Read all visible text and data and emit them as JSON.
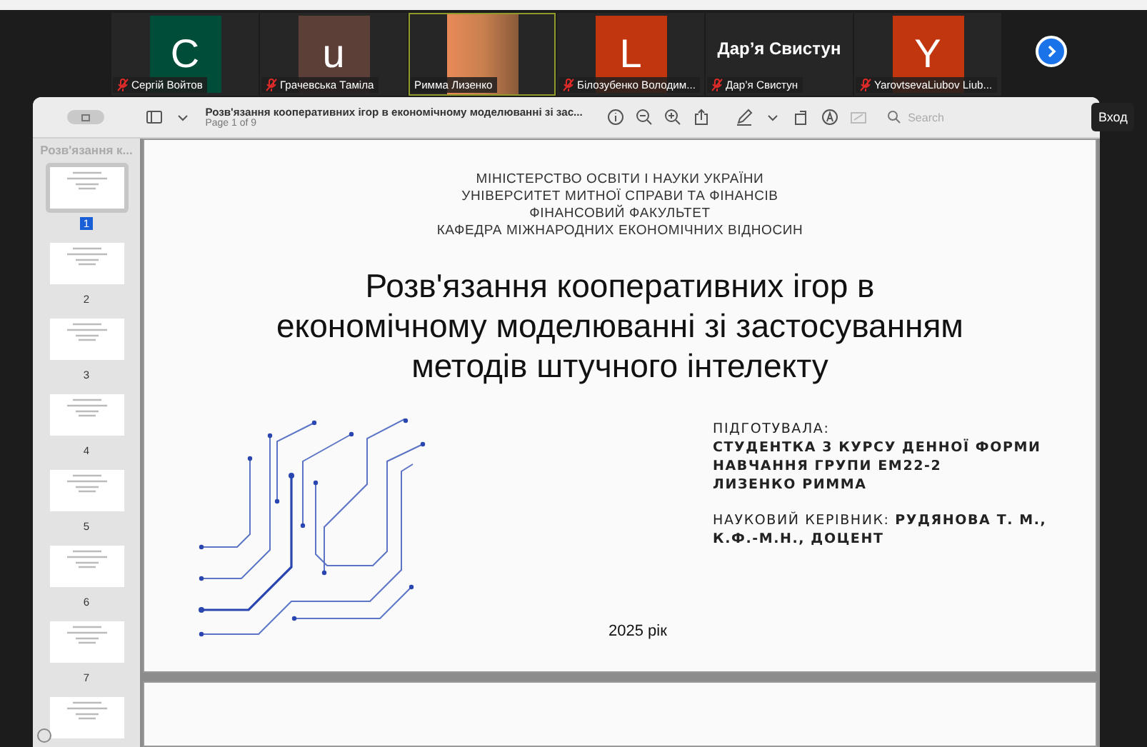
{
  "participants": [
    {
      "kind": "avatar",
      "letter": "C",
      "color": "#004d3a",
      "name": "Сергій Войтов",
      "muted": true,
      "speaking": false
    },
    {
      "kind": "avatar",
      "letter": "u",
      "color": "#5c3f37",
      "name": "Грачевська Таміла",
      "muted": true,
      "speaking": false
    },
    {
      "kind": "photo",
      "name": "Римма Лизенко",
      "muted": false,
      "speaking": true
    },
    {
      "kind": "avatar",
      "letter": "L",
      "color": "#c1360e",
      "name": "Білозубенко Володим...",
      "muted": true,
      "speaking": false
    },
    {
      "kind": "text",
      "display": "Дар’я Свистун",
      "name": "Дар’я Свистун",
      "muted": true,
      "speaking": false
    },
    {
      "kind": "avatar",
      "letter": "Y",
      "color": "#c1360e",
      "name": "YarovtsevaLiubov Liub...",
      "muted": true,
      "speaking": false
    }
  ],
  "viewer": {
    "title": "Розв'язання кооперативних ігор в економічному моделюванні зі зас...",
    "subtitle": "Page 1 of 9",
    "search": {
      "placeholder": "Search"
    }
  },
  "sidebar": {
    "title": "Розв'язання к...",
    "thumbnails": [
      {
        "number": "1",
        "selected": true
      },
      {
        "number": "2",
        "selected": false
      },
      {
        "number": "3",
        "selected": false
      },
      {
        "number": "4",
        "selected": false
      },
      {
        "number": "5",
        "selected": false
      },
      {
        "number": "6",
        "selected": false
      },
      {
        "number": "7",
        "selected": false
      },
      {
        "selected": false
      }
    ]
  },
  "slide": {
    "header": [
      "МІНІСТЕРСТВО ОСВІТИ І НАУКИ УКРАЇНИ",
      "УНІВЕРСИТЕТ МИТНОЇ СПРАВИ ТА ФІНАНСІВ",
      "ФІНАНСОВИЙ ФАКУЛЬТЕТ",
      "КАФЕДРА МІЖНАРОДНИХ ЕКОНОМІЧНИХ ВІДНОСИН"
    ],
    "title_lines": [
      "Розв'язання кооперативних ігор в",
      "економічному моделюванні зі застосуванням",
      "методів штучного інтелекту"
    ],
    "prepared_label": "ПІДГОТУВАЛА:",
    "prepared_lines": [
      "СТУДЕНТКА 3 КУРСУ ДЕННОЇ ФОРМИ",
      "НАВЧАННЯ ГРУПИ ЕМ22-2",
      "ЛИЗЕНКО РИММА"
    ],
    "supervisor_lines": [
      "НАУКОВИЙ КЕРІВНИК: **РУДЯНОВА Т. М.,**",
      "**К.Ф.-М.Н., ДОЦЕНТ**"
    ],
    "year": "2025 рік"
  },
  "login_button": "Вход"
}
